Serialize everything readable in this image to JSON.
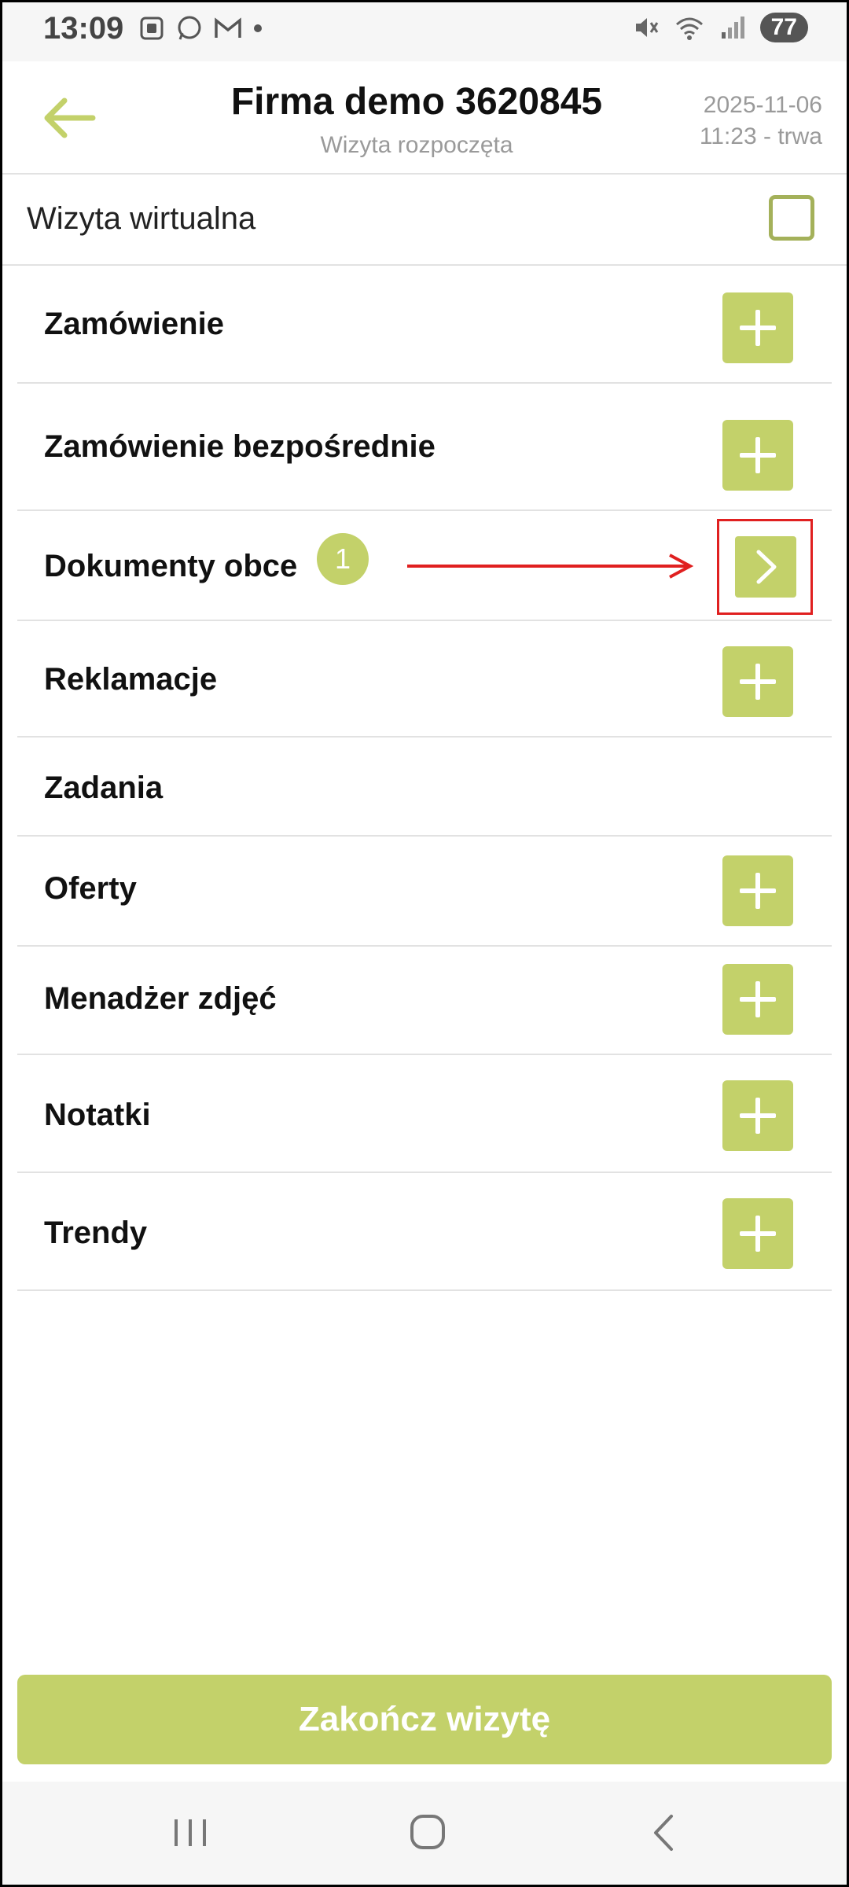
{
  "status_bar": {
    "time": "13:09",
    "battery": "77",
    "left_icons": [
      "screenshot-icon",
      "whatsapp-icon",
      "gmail-icon",
      "dot-icon"
    ],
    "right_icons": [
      "mute-icon",
      "wifi-icon",
      "signal-icon"
    ]
  },
  "header": {
    "title": "Firma demo 3620845",
    "subtitle": "Wizyta rozpoczęta",
    "date": "2025-11-06",
    "time_status": "11:23 - trwa"
  },
  "virtual_visit": {
    "label": "Wizyta wirtualna",
    "checked": false
  },
  "sections": [
    {
      "label": "Zamówienie",
      "action": "plus"
    },
    {
      "label": "Zamówienie bezpośrednie",
      "action": "plus"
    },
    {
      "label": "Dokumenty obce",
      "action": "chevron",
      "badge": "1"
    },
    {
      "label": "Reklamacje",
      "action": "plus"
    },
    {
      "label": "Zadania",
      "action": "none"
    },
    {
      "label": "Oferty",
      "action": "plus"
    },
    {
      "label": "Menadżer zdjęć",
      "action": "plus"
    },
    {
      "label": "Notatki",
      "action": "plus"
    },
    {
      "label": "Trendy",
      "action": "plus"
    }
  ],
  "footer": {
    "finish_label": "Zakończ wizytę"
  },
  "colors": {
    "accent": "#c3d16a",
    "annotation": "#e02020"
  }
}
